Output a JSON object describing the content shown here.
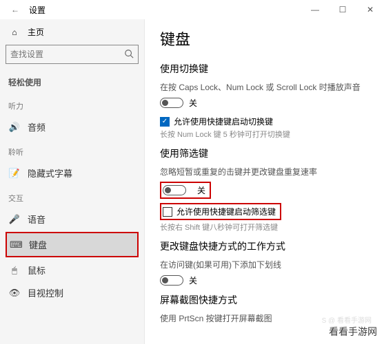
{
  "window": {
    "back_icon": "←",
    "title": "设置",
    "btn_min": "—",
    "btn_max": "☐",
    "btn_close": "✕"
  },
  "sidebar": {
    "home_icon": "⌂",
    "home_label": "主页",
    "search_placeholder": "查找设置",
    "cat_main": "轻松使用",
    "cat_hear": "听力",
    "cat_interact": "交互",
    "items_hear": [
      {
        "icon": "🔊",
        "label": "音频"
      },
      {
        "icon": "📝",
        "label": "隐藏式字幕"
      }
    ],
    "cat_hear2": "聆听",
    "items_interact": [
      {
        "icon": "🎤",
        "label": "语音"
      },
      {
        "icon": "⌨",
        "label": "键盘"
      },
      {
        "icon": "🖱",
        "label": "鼠标"
      },
      {
        "icon": "👁",
        "label": "目视控制"
      }
    ]
  },
  "main": {
    "h1": "键盘",
    "sec_toggle": {
      "h2": "使用切换键",
      "desc": "在按 Caps Lock、Num Lock 或 Scroll Lock 时播放声音",
      "toggle_label": "关",
      "check_label": "允许使用快捷键启动切换键",
      "sub": "长按 Num Lock 键 5 秒钟可打开切换键"
    },
    "sec_filter": {
      "h2": "使用筛选键",
      "desc": "忽略短暂或重复的击键并更改键盘重复速率",
      "toggle_label": "关",
      "check_label": "允许使用快捷键启动筛选键",
      "sub": "长按右 Shift 键八秒钟可打开筛选键"
    },
    "sec_shortcut": {
      "h2": "更改键盘快捷方式的工作方式",
      "desc": "在访问键(如果可用)下添加下划线",
      "toggle_label": "关"
    },
    "sec_prtsc": {
      "h2": "屏幕截图快捷方式",
      "desc": "使用 PrtScn 按键打开屏幕截图"
    }
  },
  "watermark": "看看手游网",
  "faint_mark": "S @ 看看手游网"
}
